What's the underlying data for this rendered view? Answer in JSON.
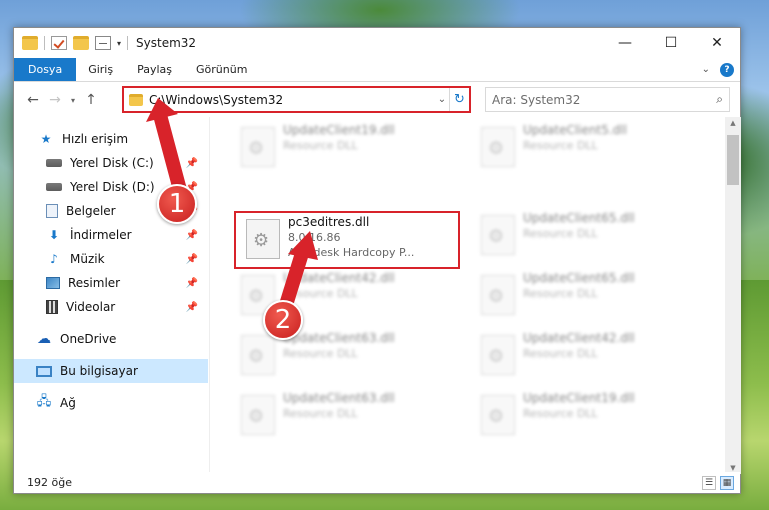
{
  "window": {
    "title": "System32",
    "min": "—",
    "max": "☐",
    "close": "✕"
  },
  "ribbon": {
    "tabs": [
      "Dosya",
      "Giriş",
      "Paylaş",
      "Görünüm"
    ]
  },
  "nav": {
    "address": "C:\\Windows\\System32",
    "search_placeholder": "Ara: System32"
  },
  "sidebar": {
    "items": [
      {
        "label": "Hızlı erişim",
        "icon": "star-icon",
        "pinned": false
      },
      {
        "label": "Yerel Disk (C:)",
        "icon": "disk-icon",
        "pinned": true
      },
      {
        "label": "Yerel Disk (D:)",
        "icon": "disk-icon",
        "pinned": true
      },
      {
        "label": "Belgeler",
        "icon": "document-icon",
        "pinned": true
      },
      {
        "label": "İndirmeler",
        "icon": "download-icon",
        "pinned": true
      },
      {
        "label": "Müzik",
        "icon": "music-icon",
        "pinned": true
      },
      {
        "label": "Resimler",
        "icon": "pictures-icon",
        "pinned": true
      },
      {
        "label": "Videolar",
        "icon": "video-icon",
        "pinned": true
      },
      {
        "label": "OneDrive",
        "icon": "cloud-icon",
        "pinned": false
      },
      {
        "label": "Bu bilgisayar",
        "icon": "computer-icon",
        "pinned": false
      },
      {
        "label": "Ağ",
        "icon": "network-icon",
        "pinned": false
      }
    ]
  },
  "files": {
    "column_left": [
      {
        "name": "UpdateClient19.dll",
        "type": "Resource DLL"
      },
      {
        "name": "UpdateClient42.dll",
        "type": "Resource DLL"
      },
      {
        "name": "UpdateClient63.dll",
        "type": "Resource DLL"
      },
      {
        "name": "UpdateClient63.dll",
        "type": "Resource DLL"
      }
    ],
    "column_right": [
      {
        "name": "UpdateClient5.dll",
        "type": "Resource DLL"
      },
      {
        "name": "UpdateClient65.dll",
        "type": "Resource DLL"
      },
      {
        "name": "UpdateClient65.dll",
        "type": "Resource DLL"
      },
      {
        "name": "UpdateClient42.dll",
        "type": "Resource DLL"
      },
      {
        "name": "UpdateClient19.dll",
        "type": "Resource DLL"
      }
    ],
    "highlighted": {
      "name": "pc3editres.dll",
      "version": "8.0.16.86",
      "company": "Autodesk Hardcopy P..."
    }
  },
  "status": {
    "count": "192 öğe"
  },
  "annotations": {
    "badge1": "1",
    "badge2": "2",
    "color": "#d8232a"
  }
}
